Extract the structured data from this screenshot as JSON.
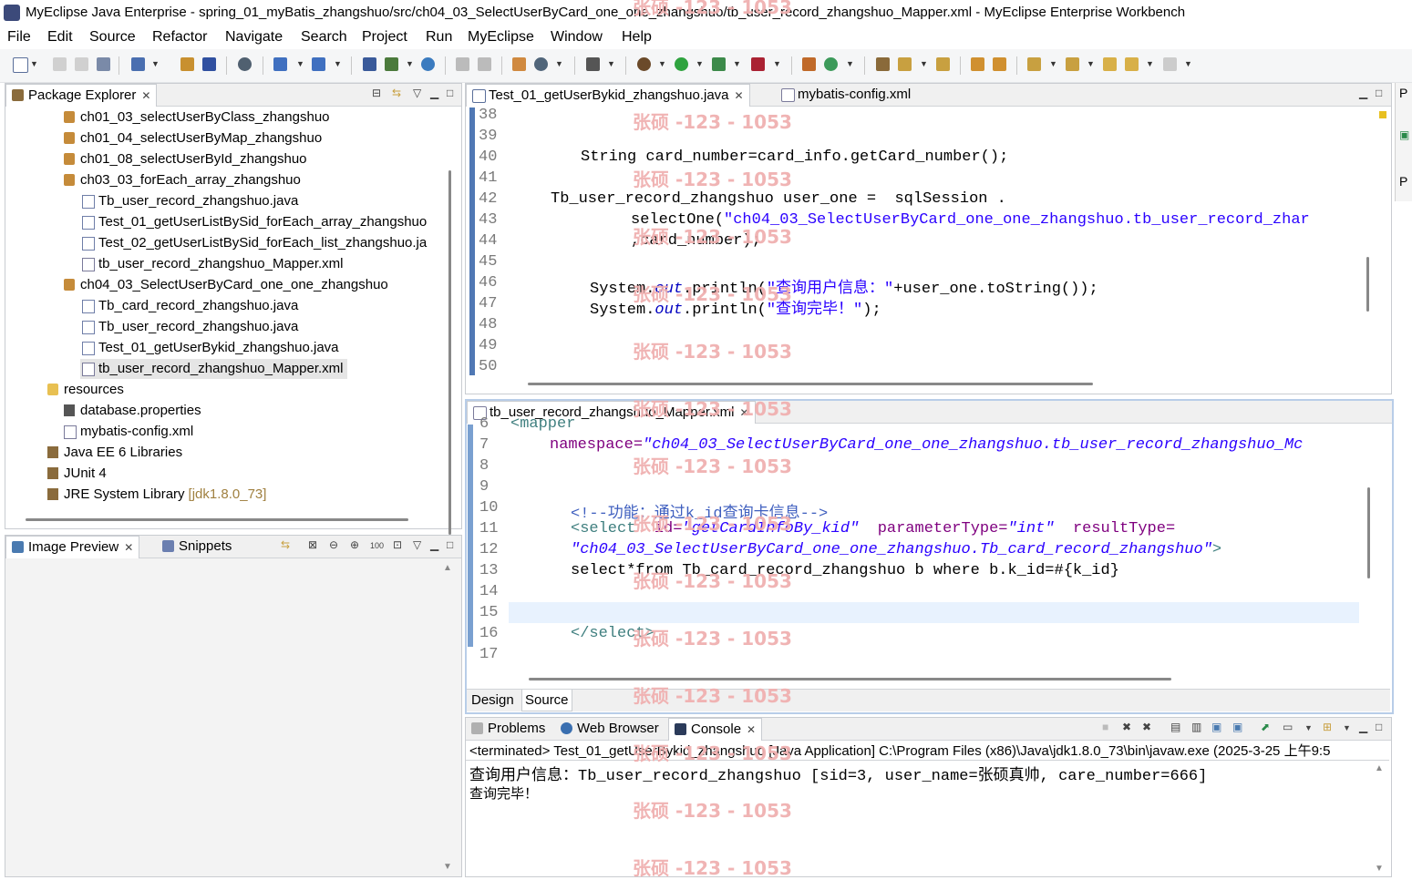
{
  "window": {
    "title": "MyEclipse Java Enterprise - spring_01_myBatis_zhangshuo/src/ch04_03_SelectUserByCard_one_one_zhangshuo/tb_user_record_zhangshuo_Mapper.xml - MyEclipse Enterprise Workbench"
  },
  "menu": [
    "File",
    "Edit",
    "Source",
    "Refactor",
    "Navigate",
    "Search",
    "Project",
    "Run",
    "MyEclipse",
    "Window",
    "Help"
  ],
  "watermark": "张硕 -123 - 1053",
  "package_explorer": {
    "tab_label": "Package Explorer",
    "items": [
      {
        "label": "ch01_03_selectUserByClass_zhangshuo",
        "type": "package"
      },
      {
        "label": "ch01_04_selectUserByMap_zhangshuo",
        "type": "package"
      },
      {
        "label": "ch01_08_selectUserById_zhangshuo",
        "type": "package"
      },
      {
        "label": "ch03_03_forEach_array_zhangshuo",
        "type": "package"
      },
      {
        "label": "Tb_user_record_zhangshuo.java",
        "type": "java"
      },
      {
        "label": "Test_01_getUserListBySid_forEach_array_zhangshuo",
        "type": "java"
      },
      {
        "label": "Test_02_getUserListBySid_forEach_list_zhangshuo.ja",
        "type": "java"
      },
      {
        "label": "tb_user_record_zhangshuo_Mapper.xml",
        "type": "xml"
      },
      {
        "label": "ch04_03_SelectUserByCard_one_one_zhangshuo",
        "type": "package"
      },
      {
        "label": "Tb_card_record_zhangshuo.java",
        "type": "java"
      },
      {
        "label": "Tb_user_record_zhangshuo.java",
        "type": "java"
      },
      {
        "label": "Test_01_getUserBykid_zhangshuo.java",
        "type": "java"
      },
      {
        "label": "tb_user_record_zhangshuo_Mapper.xml",
        "type": "xml",
        "selected": true
      },
      {
        "label": "resources",
        "type": "folder"
      },
      {
        "label": "database.properties",
        "type": "properties"
      },
      {
        "label": "mybatis-config.xml",
        "type": "xml"
      },
      {
        "label": "Java EE 6 Libraries",
        "type": "library"
      },
      {
        "label": "JUnit 4",
        "type": "library"
      },
      {
        "label": "JRE System Library",
        "type": "library",
        "suffix": "[jdk1.8.0_73]"
      }
    ]
  },
  "image_preview": {
    "tab_label": "Image Preview",
    "snippets_label": "Snippets"
  },
  "java_editor": {
    "tabs": [
      {
        "label": "Test_01_getUserBykid_zhangshuo.java",
        "active": true
      },
      {
        "label": "mybatis-config.xml",
        "active": false
      }
    ],
    "line_numbers": [
      "38",
      "39",
      "40",
      "41",
      "42",
      "43",
      "44",
      "45",
      "46",
      "47",
      "48",
      "49",
      "50"
    ],
    "code": {
      "l40": "String card_number=card_info.getCard_number();",
      "l42": "Tb_user_record_zhangshuo user_one =  sqlSession .",
      "l43_pre": "selectOne(",
      "l43_str": "\"ch04_03_SelectUserByCard_one_one_zhangshuo.tb_user_record_zhar",
      "l44": ",card_number);",
      "l46_pre": "System.",
      "l46_out": "out",
      "l46_mid": ".println(",
      "l46_str": "\"查询用户信息：\"",
      "l46_post": "+user_one.toString());",
      "l47_pre": "System.",
      "l47_out": "out",
      "l47_mid": ".println(",
      "l47_str": "\"查询完毕！\"",
      "l47_post": ");"
    }
  },
  "xml_editor": {
    "tab_label": "tb_user_record_zhangshuo_Mapper.xml",
    "line_numbers": [
      "6",
      "7",
      "8",
      "9",
      "10",
      "11",
      "12",
      "13",
      "14",
      "15",
      "16",
      "17"
    ],
    "code": {
      "l6": "<mapper",
      "l7_attr": "namespace=",
      "l7_val": "\"ch04_03_SelectUserByCard_one_one_zhangshuo.tb_user_record_zhangshuo_Mc",
      "l10": "<!--功能：通过k_id查询卡信息-->",
      "l11_tag": "<select",
      "l11_a1": "id=",
      "l11_v1": "\"getCardInfoBy_kid\"",
      "l11_a2": "parameterType=",
      "l11_v2": "\"int\"",
      "l11_a3": "resultType=",
      "l12_val": "\"ch04_03_SelectUserByCard_one_one_zhangshuo.Tb_card_record_zhangshuo\"",
      "l12_end": ">",
      "l13": "select*from Tb_card_record_zhangshuo b where b.k_id=#{k_id}",
      "l16": "</select>"
    },
    "bottom_tabs": [
      "Design",
      "Source"
    ]
  },
  "console": {
    "tabs": [
      "Problems",
      "Web Browser",
      "Console"
    ],
    "header": "<terminated> Test_01_getUserBykid_zhangshuo [Java Application] C:\\Program Files (x86)\\Java\\jdk1.8.0_73\\bin\\javaw.exe (2025-3-25 上午9:5",
    "lines": [
      "查询用户信息：Tb_user_record_zhangshuo [sid=3, user_name=张硕真帅, care_number=666]",
      "查询完毕！"
    ]
  },
  "right_panel_label": "P"
}
